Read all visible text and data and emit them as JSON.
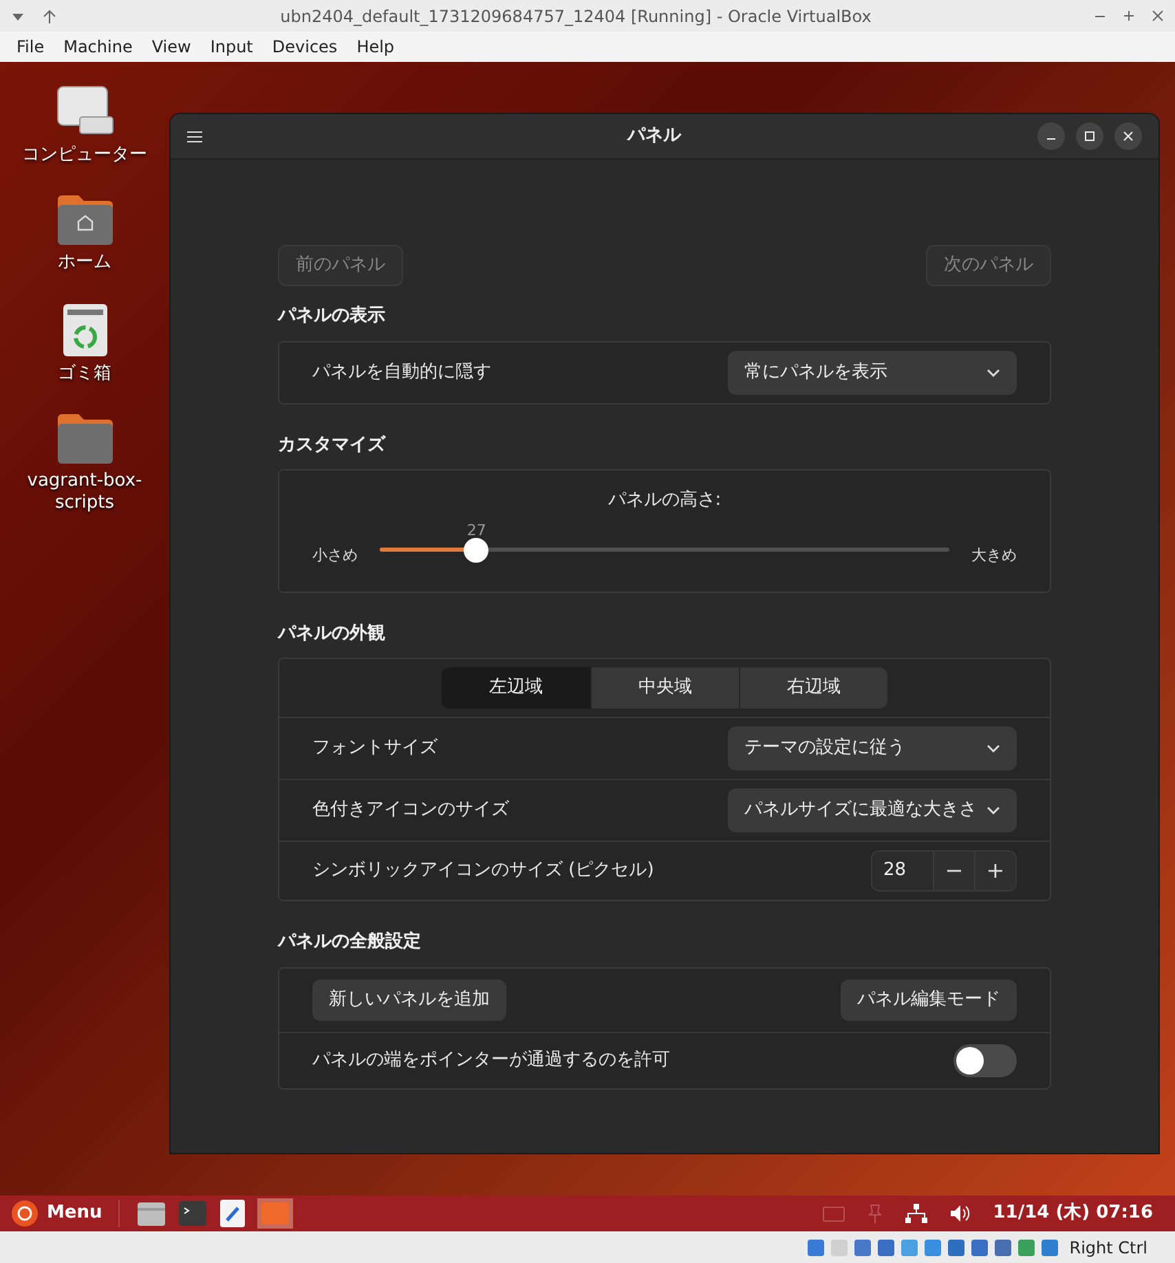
{
  "host_window": {
    "title": "ubn2404_default_1731209684757_12404 [Running] - Oracle VirtualBox",
    "menu": [
      "File",
      "Machine",
      "View",
      "Input",
      "Devices",
      "Help"
    ]
  },
  "desktop_icons": [
    {
      "kind": "computer",
      "label": "コンピューター"
    },
    {
      "kind": "home",
      "label": "ホーム"
    },
    {
      "kind": "trash",
      "label": "ゴミ箱"
    },
    {
      "kind": "folder",
      "label": "vagrant-box-scripts"
    }
  ],
  "dialog": {
    "title": "パネル",
    "nav": {
      "prev": "前のパネル",
      "next": "次のパネル"
    },
    "sections": [
      {
        "kind": "rows",
        "title": "パネルの表示",
        "rows": [
          {
            "kind": "dropdown",
            "label": "パネルを自動的に隠す",
            "value": "常にパネルを表示"
          }
        ]
      },
      {
        "kind": "slider",
        "title": "カスタマイズ",
        "slider": {
          "label": "パネルの高さ:",
          "reading": "27",
          "min_label": "小さめ",
          "max_label": "大きめ",
          "level": 0.17
        }
      },
      {
        "kind": "rows",
        "title": "パネルの外観",
        "tabs": [
          {
            "label": "左辺域",
            "selected": true
          },
          {
            "label": "中央域",
            "selected": false
          },
          {
            "label": "右辺域",
            "selected": false
          }
        ],
        "rows": [
          {
            "kind": "dropdown",
            "label": "フォントサイズ",
            "value": "テーマの設定に従う"
          },
          {
            "kind": "dropdown",
            "label": "色付きアイコンのサイズ",
            "value": "パネルサイズに最適な大きさ"
          },
          {
            "kind": "spin",
            "label": "シンボリックアイコンのサイズ (ピクセル)",
            "value": "28",
            "minus": "−",
            "plus": "+"
          }
        ]
      },
      {
        "kind": "rows",
        "title": "パネルの全般設定",
        "rows": [
          {
            "kind": "buttons",
            "buttons": [
              "新しいパネルを追加",
              "パネル編集モード"
            ]
          },
          {
            "kind": "switch",
            "label": "パネルの端をポインターが通過するのを許可",
            "on": false
          }
        ]
      }
    ]
  },
  "taskbar": {
    "menu": "Menu",
    "launchers": [
      {
        "kind": "files"
      },
      {
        "kind": "terminal"
      },
      {
        "kind": "editor"
      },
      {
        "kind": "window"
      }
    ],
    "clock": "11/14 (木) 07:16"
  },
  "status_bar": {
    "host_key": "Right Ctrl"
  }
}
